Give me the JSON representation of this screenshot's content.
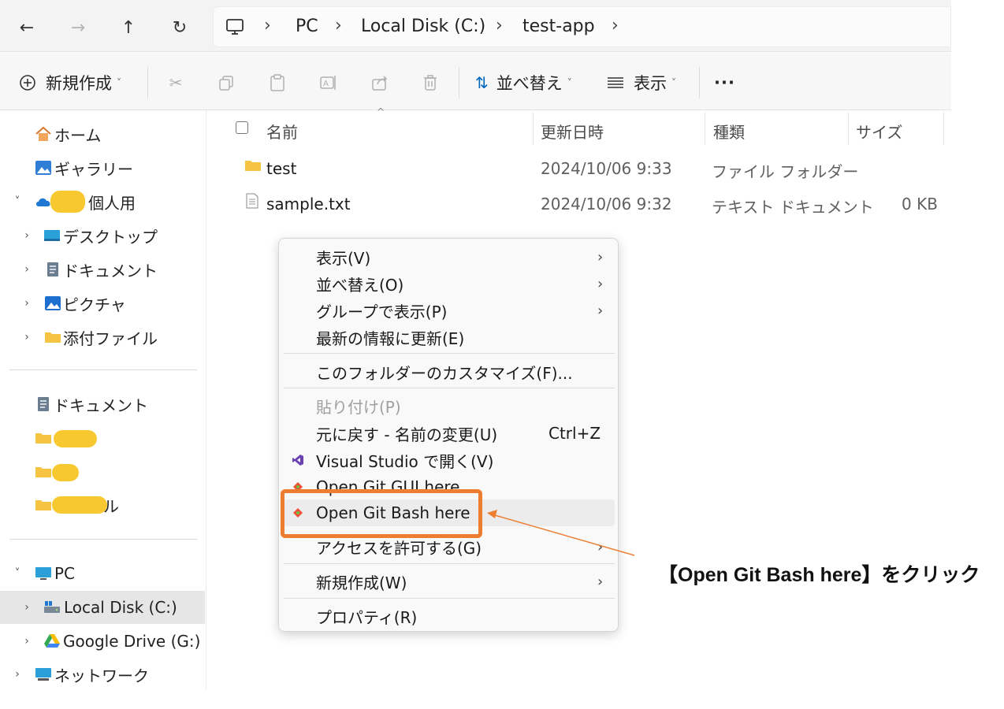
{
  "nav": {
    "back": "←",
    "forward": "→",
    "up": "↑",
    "refresh": "↻"
  },
  "breadcrumb": {
    "sep": "›",
    "items": [
      "PC",
      "Local Disk (C:)",
      "test-app"
    ]
  },
  "commandbar": {
    "new_label": "新規作成",
    "sort_label": "並べ替え",
    "view_label": "表示",
    "more_label": "···",
    "caret": "˅"
  },
  "sidebar": {
    "home": "ホーム",
    "gallery": "ギャラリー",
    "onedrive_suffix": "個人用",
    "desktop": "デスクトップ",
    "documents": "ドキュメント",
    "pictures": "ピクチャ",
    "attachments": "添付ファイル",
    "pinned_documents": "ドキュメント",
    "pinned_partial_3": "ル",
    "pc": "PC",
    "local_disk": "Local Disk (C:)",
    "google_drive": "Google Drive (G:)",
    "network": "ネットワーク",
    "expander_closed": "›",
    "expander_open": "˅"
  },
  "columns": {
    "name": "名前",
    "modified": "更新日時",
    "type": "種類",
    "size": "サイズ"
  },
  "files": [
    {
      "name": "test",
      "modified": "2024/10/06 9:33",
      "type": "ファイル フォルダー",
      "size": ""
    },
    {
      "name": "sample.txt",
      "modified": "2024/10/06 9:32",
      "type": "テキスト ドキュメント",
      "size": "0 KB"
    }
  ],
  "context_menu": {
    "view": "表示(V)",
    "sort": "並べ替え(O)",
    "group": "グループで表示(P)",
    "refresh": "最新の情報に更新(E)",
    "customize": "このフォルダーのカスタマイズ(F)...",
    "paste": "貼り付け(P)",
    "undo": "元に戻す - 名前の変更(U)",
    "undo_shortcut": "Ctrl+Z",
    "open_vs": "Visual Studio で開く(V)",
    "open_git_gui": "Open Git GUI here",
    "open_git_bash": "Open Git Bash here",
    "give_access": "アクセスを許可する(G)",
    "new": "新規作成(W)",
    "properties": "プロパティ(R)",
    "submenu_arrow": "›"
  },
  "annotation": {
    "callout": "【Open Git Bash here】をクリック",
    "highlight_color": "#ed7d31"
  },
  "colors": {
    "folder": "#f6c343",
    "accent": "#0067c0",
    "selected_bg": "#e6e6e6"
  }
}
